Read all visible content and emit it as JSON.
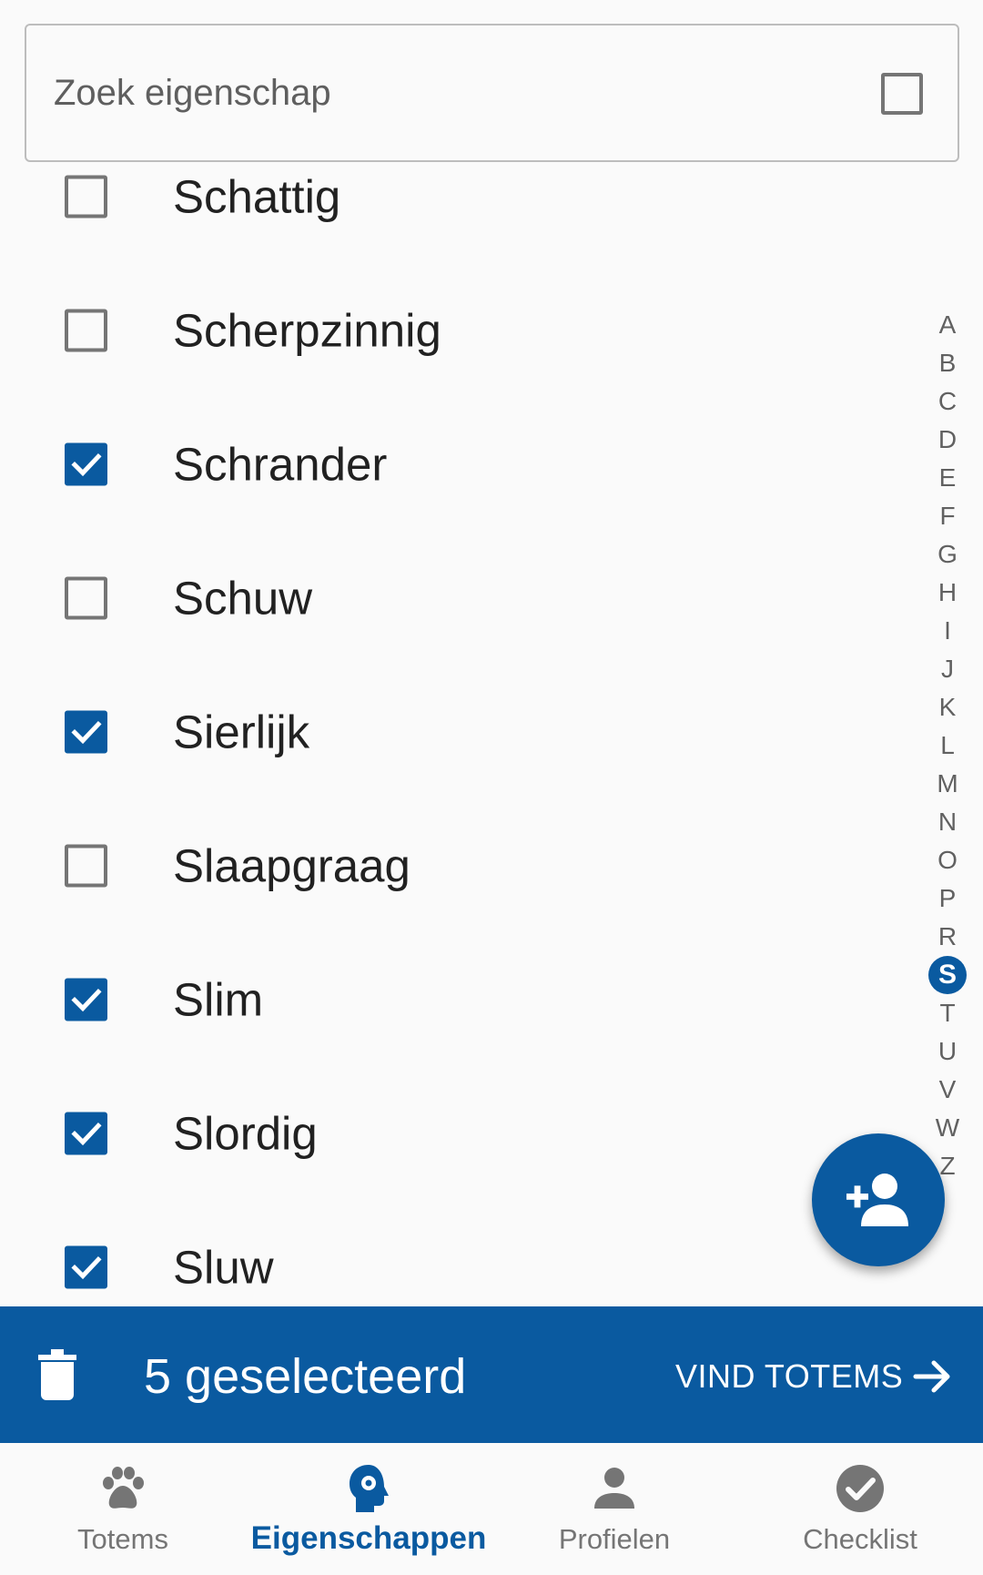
{
  "search": {
    "placeholder": "Zoek eigenschap"
  },
  "items": [
    {
      "label": "Schattig",
      "checked": false
    },
    {
      "label": "Scherpzinnig",
      "checked": false
    },
    {
      "label": "Schrander",
      "checked": true
    },
    {
      "label": "Schuw",
      "checked": false
    },
    {
      "label": "Sierlijk",
      "checked": true
    },
    {
      "label": "Slaapgraag",
      "checked": false
    },
    {
      "label": "Slim",
      "checked": true
    },
    {
      "label": "Slordig",
      "checked": true
    },
    {
      "label": "Sluw",
      "checked": true
    }
  ],
  "alphabet": [
    "A",
    "B",
    "C",
    "D",
    "E",
    "F",
    "G",
    "H",
    "I",
    "J",
    "K",
    "L",
    "M",
    "N",
    "O",
    "P",
    "R",
    "S",
    "T",
    "U",
    "V",
    "W",
    "Z"
  ],
  "alphabet_active": "S",
  "selection": {
    "count_text": "5 geselecteerd",
    "action_label": "VIND TOTEMS"
  },
  "nav": [
    {
      "label": "Totems",
      "icon": "paw-icon",
      "active": false
    },
    {
      "label": "Eigenschappen",
      "icon": "head-gear-icon",
      "active": true
    },
    {
      "label": "Profielen",
      "icon": "person-icon",
      "active": false
    },
    {
      "label": "Checklist",
      "icon": "check-circle-icon",
      "active": false
    }
  ],
  "colors": {
    "primary": "#0a5aa0",
    "background": "#fafafa",
    "text": "#212121",
    "muted": "#757575"
  }
}
